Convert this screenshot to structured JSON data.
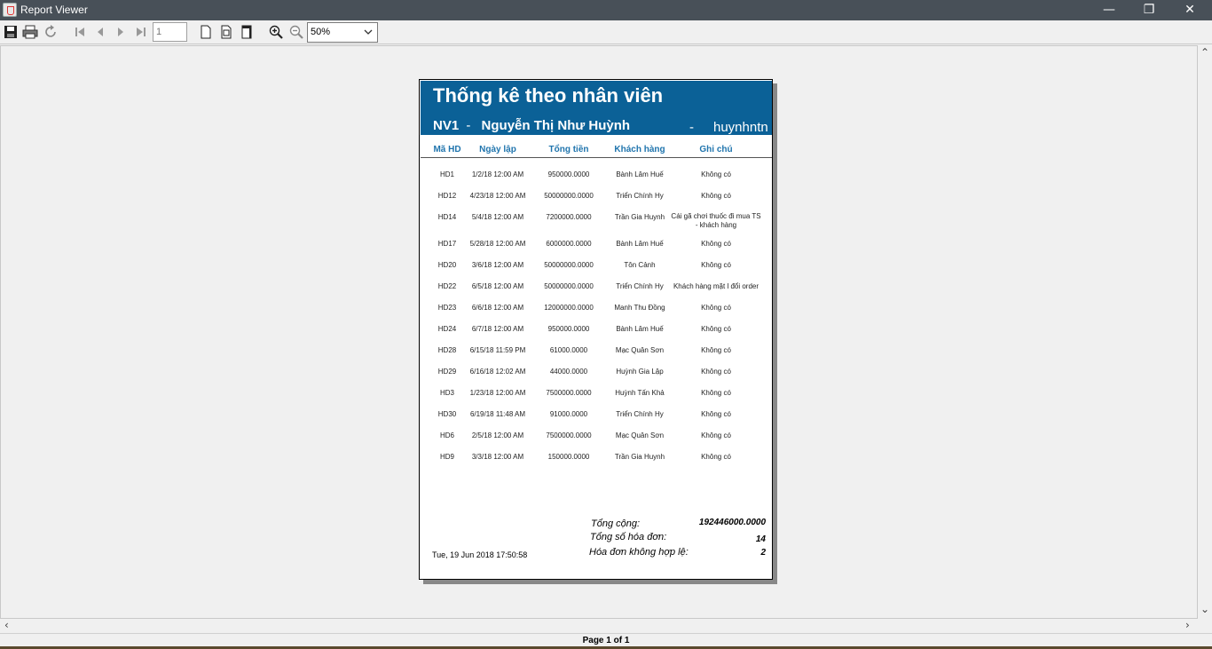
{
  "window": {
    "title": "Report Viewer",
    "minimize": "—",
    "maximize": "❐",
    "close": "✕"
  },
  "toolbar": {
    "page_number": "1",
    "zoom": "50%",
    "zoom_options": [
      "50%"
    ]
  },
  "report": {
    "title": "Thống kê theo nhân viên",
    "employee_id": "NV1",
    "dash": "-",
    "employee_name": "Nguyễn Thị Như Huỳnh",
    "username": "huynhntn",
    "columns": [
      "Mã HD",
      "Ngày lập",
      "Tổng tiền",
      "Khách hàng",
      "Ghi chú"
    ],
    "rows": [
      {
        "id": "HD1",
        "date": "1/2/18 12:00 AM",
        "amount": "950000.0000",
        "customer": "Bành Lâm Huế",
        "note": "Không có"
      },
      {
        "id": "HD12",
        "date": "4/23/18 12:00 AM",
        "amount": "50000000.0000",
        "customer": "Triển Chính Hy",
        "note": "Không có"
      },
      {
        "id": "HD14",
        "date": "5/4/18 12:00 AM",
        "amount": "7200000.0000",
        "customer": "Trần Gia Huynh",
        "note": "Cái gã chơi thuốc đi mua TS - khách hàng"
      },
      {
        "id": "HD17",
        "date": "5/28/18 12:00 AM",
        "amount": "6000000.0000",
        "customer": "Bành Lâm Huế",
        "note": "Không có"
      },
      {
        "id": "HD20",
        "date": "3/6/18 12:00 AM",
        "amount": "50000000.0000",
        "customer": "Tôn Cảnh",
        "note": "Không có"
      },
      {
        "id": "HD22",
        "date": "6/5/18 12:00 AM",
        "amount": "50000000.0000",
        "customer": "Triển Chính Hy",
        "note": "Khách hàng mặt l đổi order"
      },
      {
        "id": "HD23",
        "date": "6/6/18 12:00 AM",
        "amount": "12000000.0000",
        "customer": "Manh Thu Đồng",
        "note": "Không có"
      },
      {
        "id": "HD24",
        "date": "6/7/18 12:00 AM",
        "amount": "950000.0000",
        "customer": "Bành Lâm Huế",
        "note": "Không có"
      },
      {
        "id": "HD28",
        "date": "6/15/18 11:59 PM",
        "amount": "61000.0000",
        "customer": "Mạc Quân Sơn",
        "note": "Không có"
      },
      {
        "id": "HD29",
        "date": "6/16/18 12:02 AM",
        "amount": "44000.0000",
        "customer": "Huỳnh Gia Lập",
        "note": "Không có"
      },
      {
        "id": "HD3",
        "date": "1/23/18 12:00 AM",
        "amount": "7500000.0000",
        "customer": "Huỳnh Tấn Khả",
        "note": "Không có"
      },
      {
        "id": "HD30",
        "date": "6/19/18 11:48 AM",
        "amount": "91000.0000",
        "customer": "Triển Chính Hy",
        "note": "Không có"
      },
      {
        "id": "HD6",
        "date": "2/5/18 12:00 AM",
        "amount": "7500000.0000",
        "customer": "Mạc Quân Sơn",
        "note": "Không có"
      },
      {
        "id": "HD9",
        "date": "3/3/18 12:00 AM",
        "amount": "150000.0000",
        "customer": "Trần Gia Huynh",
        "note": "Không có"
      }
    ],
    "summary": {
      "total_label": "Tổng cộng:",
      "total_value": "192446000.0000",
      "count_label": "Tổng số hóa đơn:",
      "count_value": "14",
      "invalid_label": "Hóa đơn không hợp lệ:",
      "invalid_value": "2"
    },
    "printed_at": "Tue, 19 Jun 2018 17:50:58"
  },
  "status": {
    "page_label": "Page 1 of 1"
  },
  "colors": {
    "header_band": "#0b6197",
    "column_header": "#1f74ad",
    "titlebar": "#485058"
  }
}
